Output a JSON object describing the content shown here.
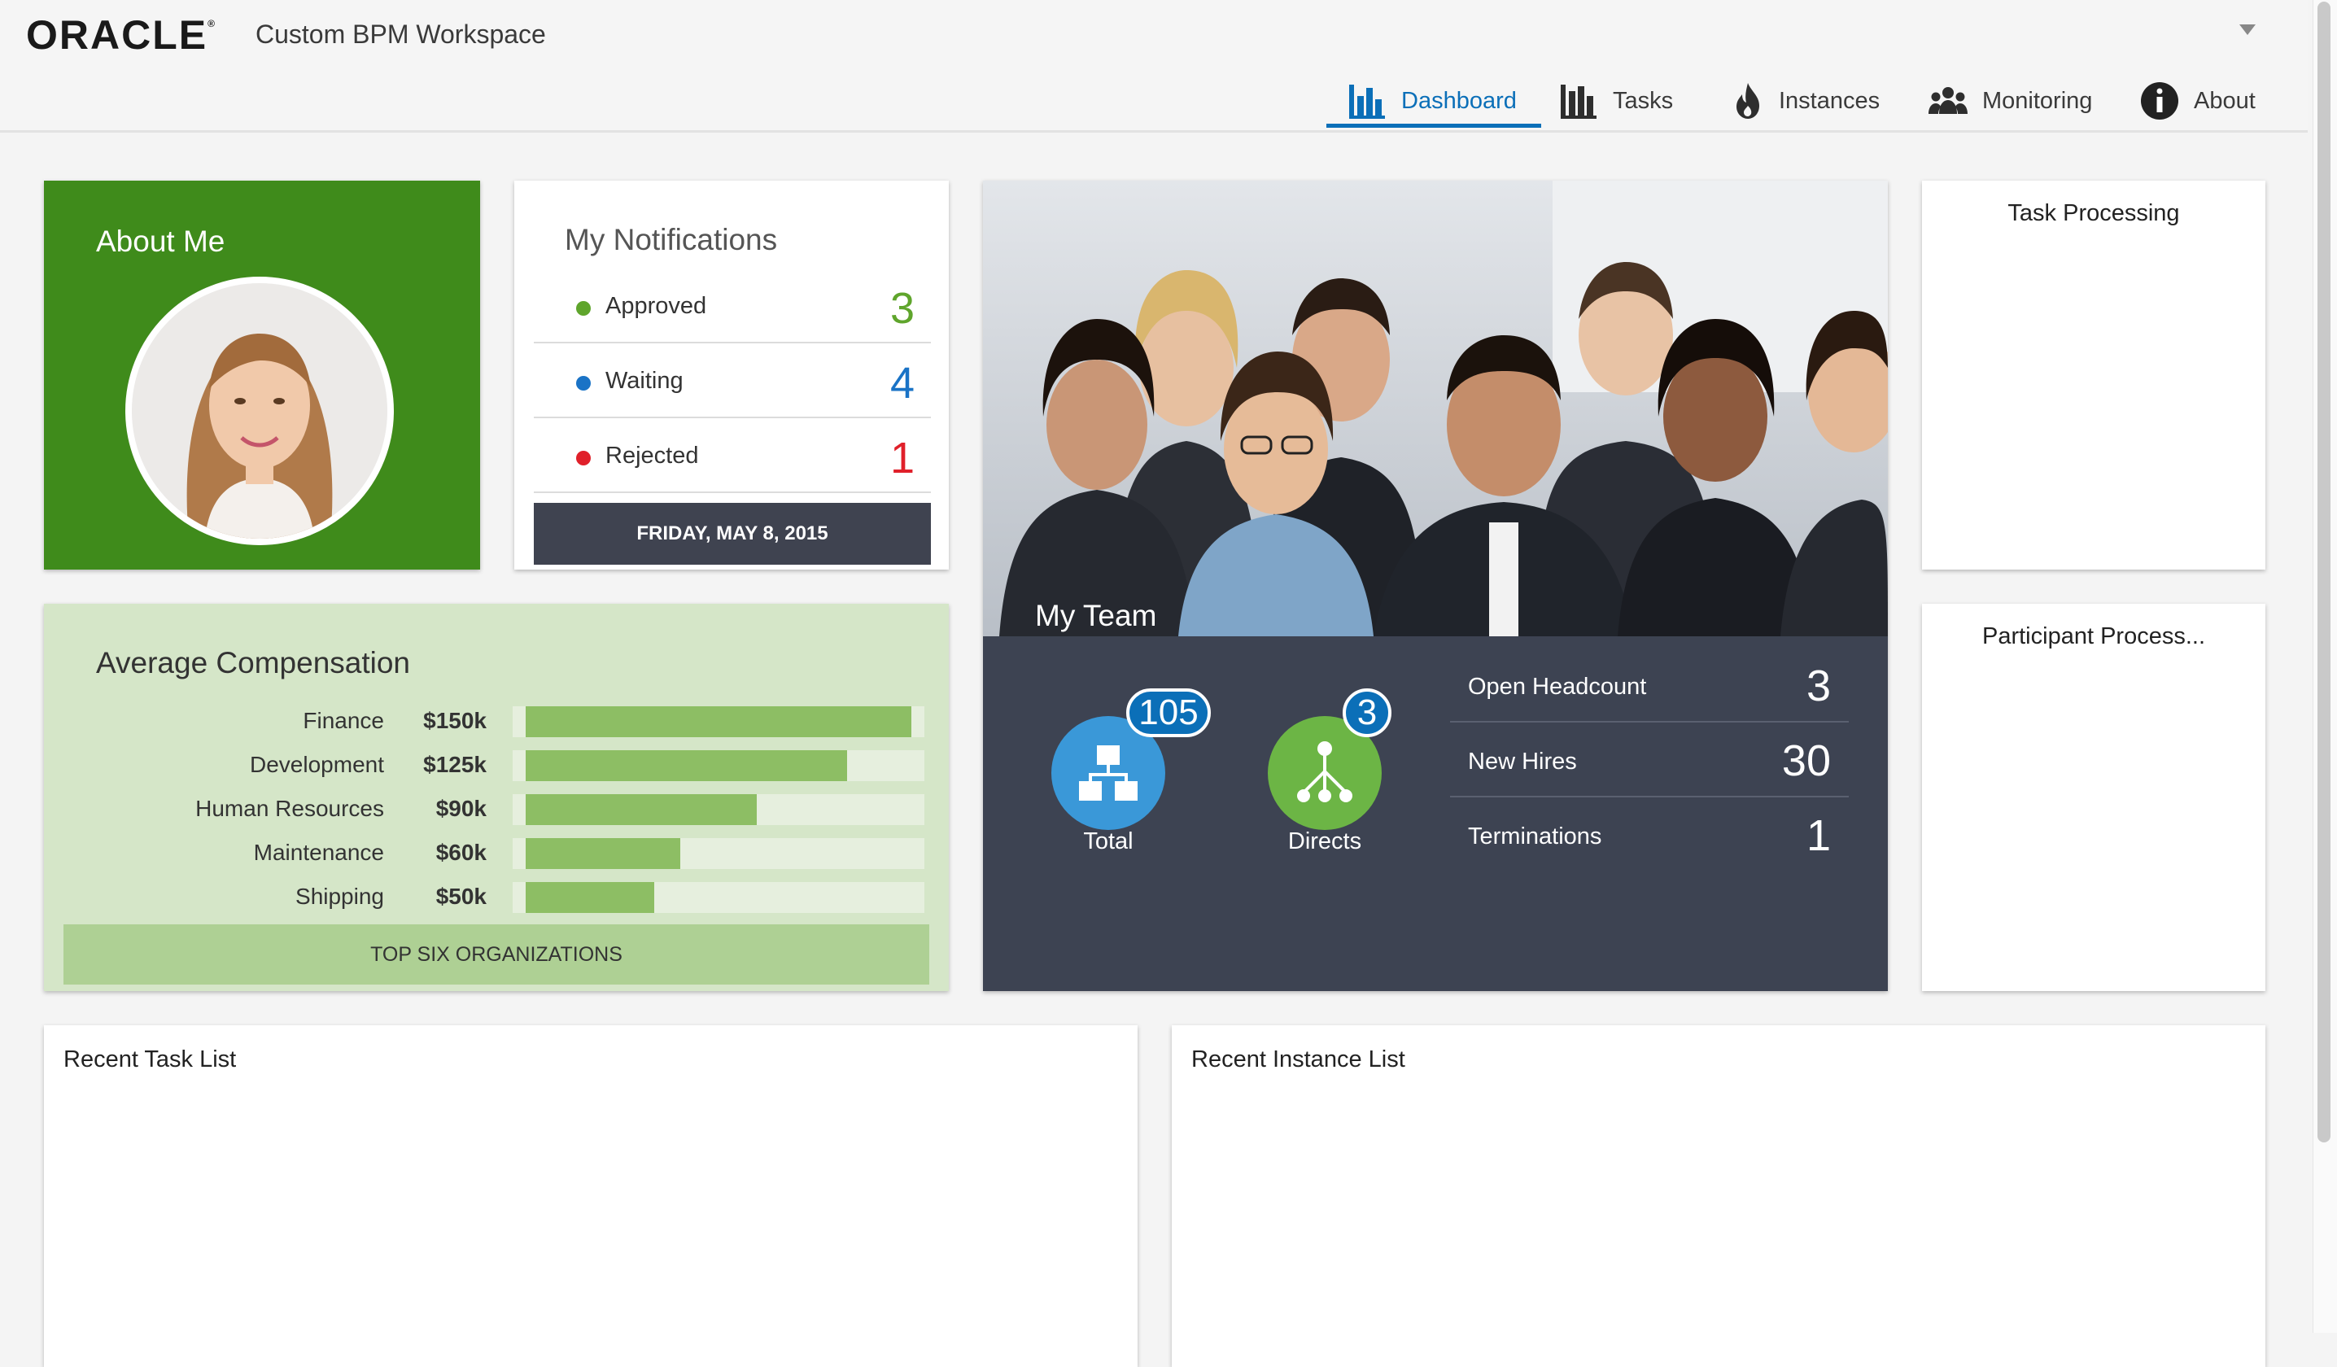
{
  "header": {
    "brand": "ORACLE",
    "app_title": "Custom BPM Workspace"
  },
  "nav": {
    "tabs": [
      {
        "label": "Dashboard",
        "icon": "bar-chart-icon",
        "active": true
      },
      {
        "label": "Tasks",
        "icon": "bar-chart-icon",
        "active": false
      },
      {
        "label": "Instances",
        "icon": "flame-icon",
        "active": false
      },
      {
        "label": "Monitoring",
        "icon": "group-icon",
        "active": false
      },
      {
        "label": "About",
        "icon": "info-icon",
        "active": false
      }
    ]
  },
  "about_me": {
    "title": "About Me"
  },
  "notifications": {
    "title": "My Notifications",
    "items": [
      {
        "label": "Approved",
        "count": "3",
        "color": "#5fa52c"
      },
      {
        "label": "Waiting",
        "count": "4",
        "color": "#1a73c6"
      },
      {
        "label": "Rejected",
        "count": "1",
        "color": "#e0202a"
      }
    ],
    "date": "FRIDAY, MAY 8, 2015"
  },
  "my_team": {
    "title": "My Team",
    "total": {
      "label": "Total",
      "count": "105"
    },
    "directs": {
      "label": "Directs",
      "count": "3"
    },
    "stats": [
      {
        "label": "Open Headcount",
        "value": "3"
      },
      {
        "label": "New Hires",
        "value": "30"
      },
      {
        "label": "Terminations",
        "value": "1"
      }
    ]
  },
  "task_processing": {
    "title": "Task Processing"
  },
  "participant_process": {
    "title": "Participant Process..."
  },
  "avg_compensation": {
    "title": "Average Compensation",
    "footer": "TOP SIX ORGANIZATIONS"
  },
  "recent_task_list": {
    "title": "Recent Task List"
  },
  "recent_instance_list": {
    "title": "Recent Instance List"
  },
  "chart_data": {
    "type": "bar",
    "orientation": "horizontal",
    "categories": [
      "Finance",
      "Development",
      "Human Resources",
      "Maintenance",
      "Shipping"
    ],
    "labels": [
      "$150k",
      "$125k",
      "$90k",
      "$60k",
      "$50k"
    ],
    "values": [
      150,
      125,
      90,
      60,
      50
    ],
    "title": "Average Compensation"
  },
  "colors": {
    "accent": "#0b6fb8",
    "about_me_bg": "#3f8b1b",
    "team_panel_bg": "#3d4352",
    "compensation_bg": "#d5e6c8",
    "bar": "#8dbe64"
  }
}
